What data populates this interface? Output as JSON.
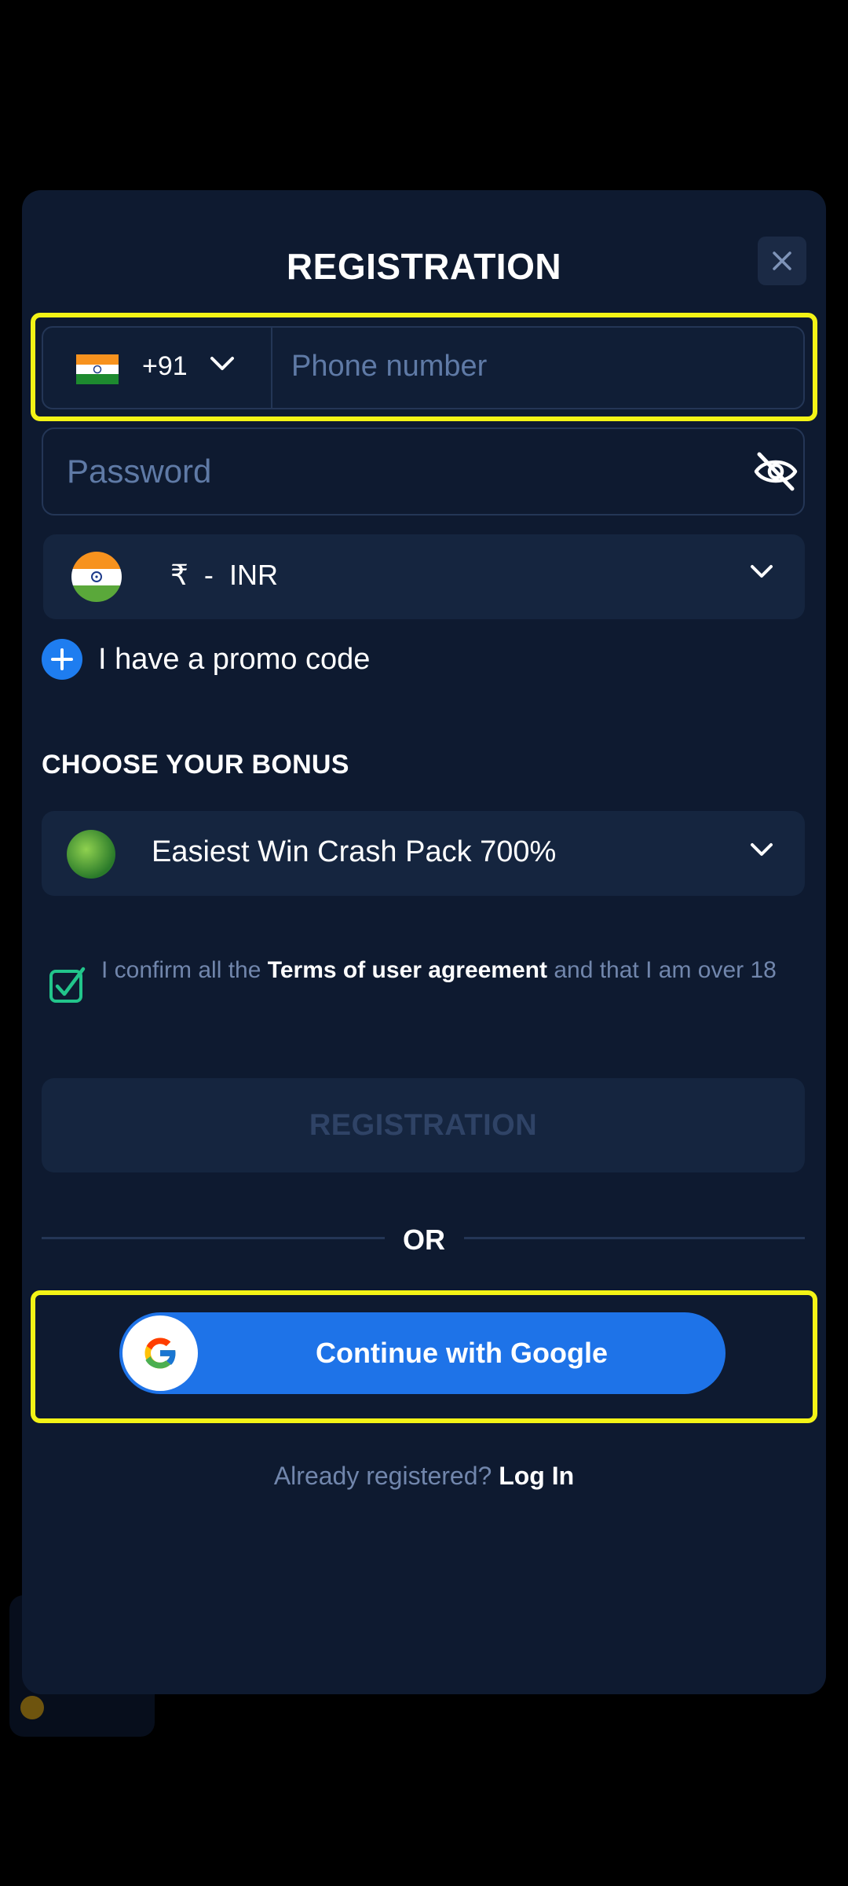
{
  "modal": {
    "title": "REGISTRATION",
    "close_icon": "close-icon"
  },
  "phone": {
    "country_code": "+91",
    "placeholder": "Phone number",
    "flag": "india-flag"
  },
  "password": {
    "placeholder": "Password",
    "visibility_icon": "eye-off-icon"
  },
  "currency": {
    "symbol": "₹",
    "separator": "-",
    "code": "INR"
  },
  "promo": {
    "label": "I have a promo code"
  },
  "bonus": {
    "heading": "CHOOSE YOUR BONUS",
    "selected": "Easiest Win Crash Pack 700%"
  },
  "terms": {
    "prefix": "I confirm all the ",
    "link": "Terms of user agreement",
    "suffix": " and that I am over 18",
    "checked": true
  },
  "register_button": "REGISTRATION",
  "divider": "OR",
  "google_button": "Continue with Google",
  "login": {
    "question": "Already registered?",
    "link": "Log In"
  },
  "colors": {
    "modal_bg": "#0e1a30",
    "field_bg": "#15253f",
    "accent_blue": "#1e73e8",
    "highlight": "#f3f316",
    "check_green": "#22c58b",
    "muted_text": "#7186ac"
  }
}
